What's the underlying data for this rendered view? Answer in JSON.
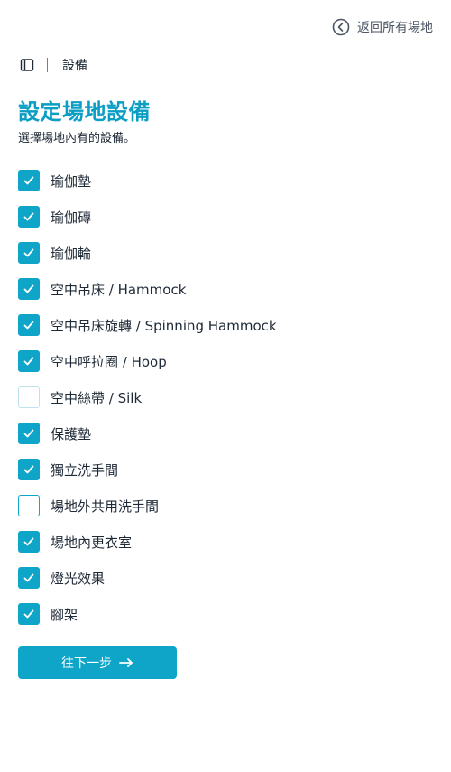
{
  "header": {
    "back_link_label": "返回所有場地",
    "back_icon": "chevron-left-circle-icon"
  },
  "breadcrumb": {
    "toggle_icon": "sidebar-toggle-icon",
    "current": "設備"
  },
  "main": {
    "title": "設定場地設備",
    "subtitle": "選擇場地內有的設備。"
  },
  "equipment": [
    {
      "label": "瑜伽墊",
      "checked": true
    },
    {
      "label": "瑜伽磚",
      "checked": true
    },
    {
      "label": "瑜伽輪",
      "checked": true
    },
    {
      "label": "空中吊床 / Hammock",
      "checked": true
    },
    {
      "label": "空中吊床旋轉 / Spinning Hammock",
      "checked": true
    },
    {
      "label": "空中呼拉圈 / Hoop",
      "checked": true
    },
    {
      "label": "空中絲帶 / Silk",
      "checked": false
    },
    {
      "label": "保護墊",
      "checked": true
    },
    {
      "label": "獨立洗手間",
      "checked": true
    },
    {
      "label": "場地外共用洗手間",
      "checked": false
    },
    {
      "label": "場地內更衣室",
      "checked": true
    },
    {
      "label": "燈光效果",
      "checked": true
    },
    {
      "label": "腳架",
      "checked": true
    }
  ],
  "actions": {
    "next_label": "往下一步",
    "next_icon": "arrow-right-icon"
  },
  "colors": {
    "accent": "#0ea5c9",
    "title": "#0b9ec5",
    "text": "#1f2a37",
    "muted": "#4b5563"
  }
}
